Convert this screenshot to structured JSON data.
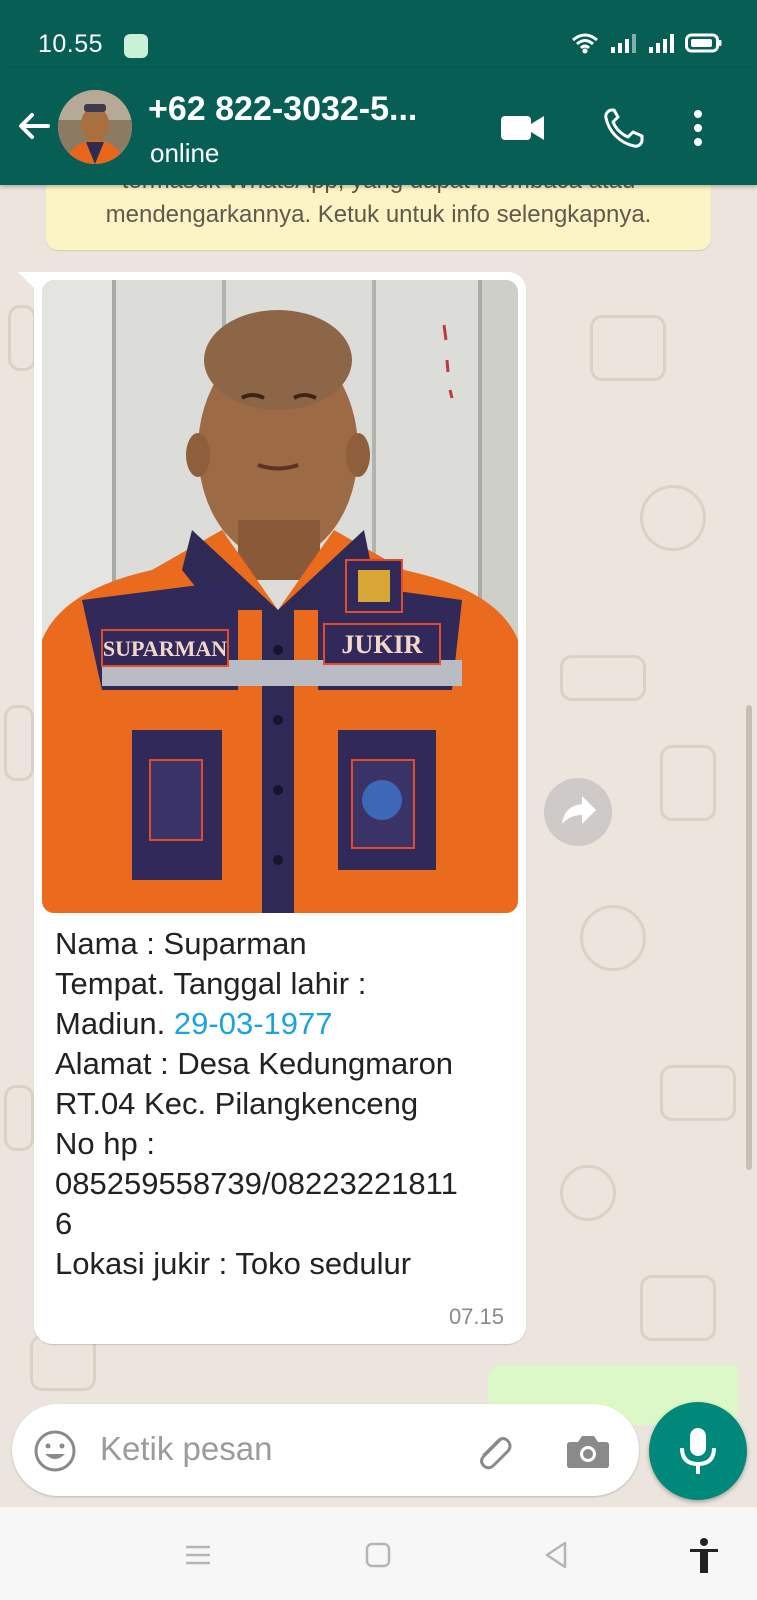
{
  "status_bar": {
    "time": "10.55"
  },
  "header": {
    "contact_name": "+62 822-3032-5...",
    "contact_status": "online"
  },
  "encryption_notice": {
    "text": "termasuk WhatsApp, yang dapat membaca atau mendengarkannya. Ketuk untuk info selengkapnya."
  },
  "message": {
    "photo_badge_left": "SUPARMAN",
    "photo_badge_right": "JUKIR",
    "lines": {
      "name": "Nama : Suparman",
      "birth_label": "Tempat. Tanggal lahir :",
      "birth_place": "Madiun. ",
      "birth_date": "29-03-1977",
      "address_1": "Alamat : Desa Kedungmaron",
      "address_2": "RT.04 Kec. Pilangkenceng",
      "phone_label": "No hp :",
      "phone_1": "085259558739/08223221811",
      "phone_2": "6",
      "location": "Lokasi jukir : Toko sedulur"
    },
    "time": "07.15"
  },
  "composer": {
    "placeholder": "Ketik pesan"
  },
  "icons": {
    "back": "arrow-left",
    "video": "video-camera",
    "call": "phone",
    "menu": "more-vertical",
    "forward": "share-arrow",
    "emoji": "smiley",
    "attach": "paperclip",
    "camera": "camera",
    "mic": "microphone",
    "nav_menu": "hamburger",
    "nav_home": "square",
    "nav_back": "triangle-left",
    "accessibility": "person"
  },
  "colors": {
    "header_bg": "#075e54",
    "chat_bg": "#ece5dd",
    "notice_bg": "#fdf4c5",
    "outgoing_bubble": "#dcf8c6",
    "fab": "#00897b",
    "link": "#1aa3e0"
  }
}
